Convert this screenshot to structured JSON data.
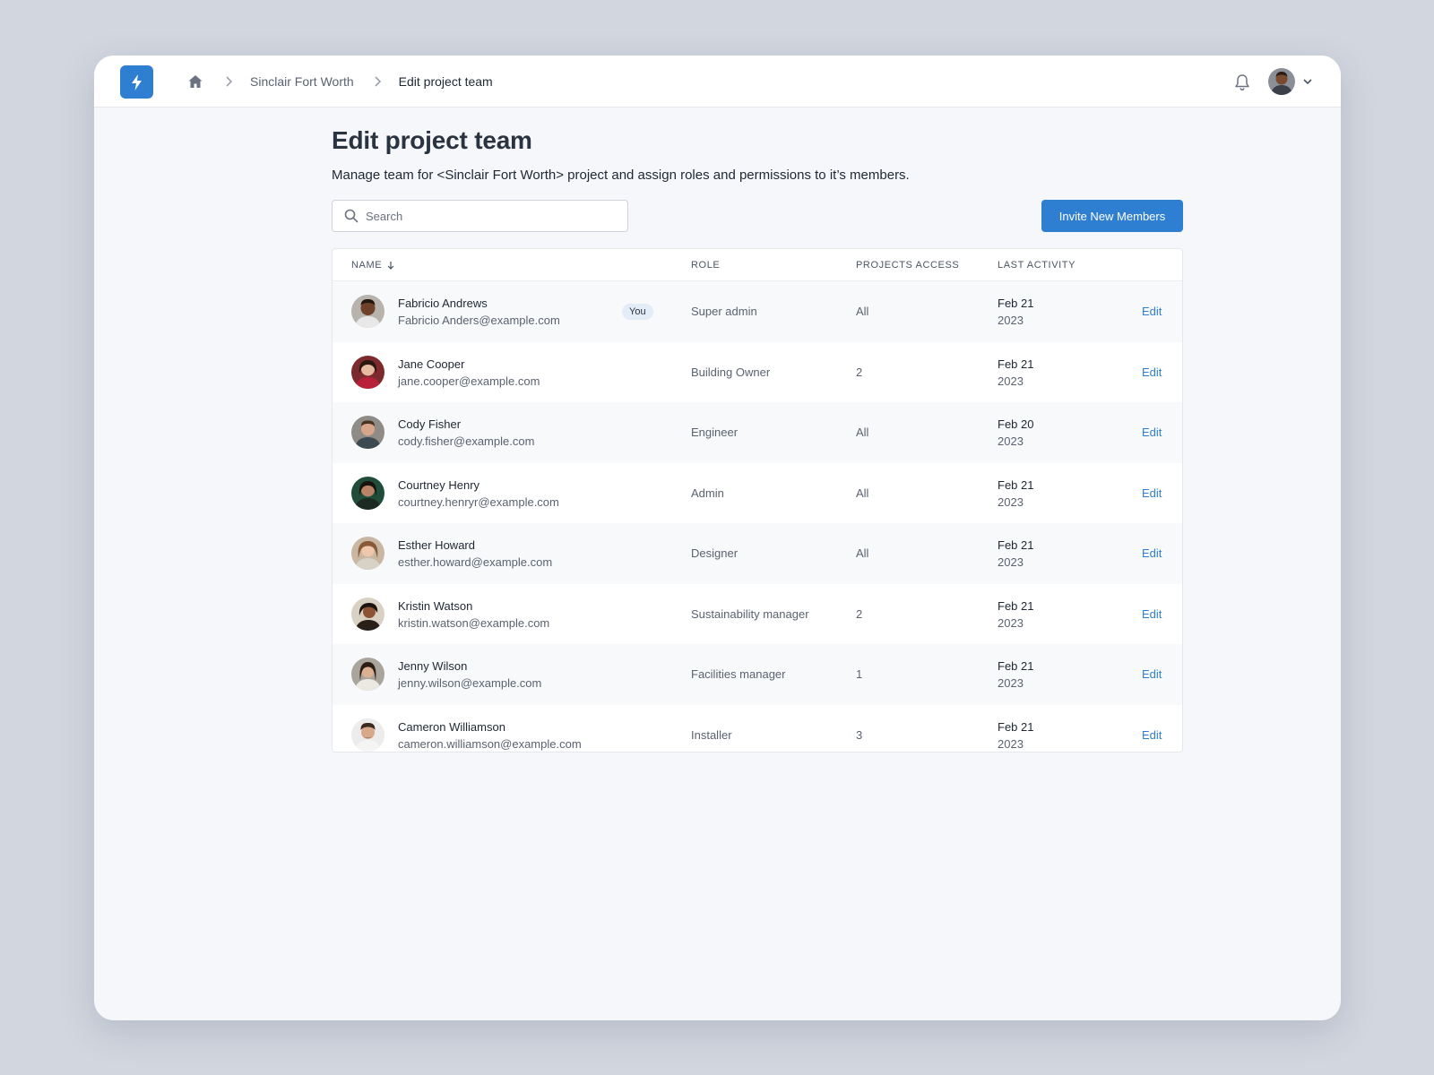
{
  "header": {
    "breadcrumb": [
      "Sinclair Fort Worth",
      "Edit project team"
    ],
    "icons": [
      "lightning-logo-icon",
      "home-icon",
      "chevron-right-icon",
      "bell-icon",
      "chevron-down-icon"
    ]
  },
  "page": {
    "title": "Edit project team",
    "subtitle": "Manage team for <Sinclair Fort Worth> project and assign roles and permissions to it’s members."
  },
  "toolbar": {
    "search_placeholder": "Search",
    "invite_label": "Invite New Members"
  },
  "table": {
    "columns": [
      "NAME",
      "ROLE",
      "PROJECTS ACCESS",
      "LAST ACTIVITY"
    ],
    "sort": "name-descending-arrow",
    "rows": [
      {
        "name": "Fabricio Andrews",
        "email": "Fabricio Anders@example.com",
        "badge": "You",
        "role": "Super admin",
        "access": "All",
        "date": "Feb 21",
        "year": "2023",
        "action": "Edit"
      },
      {
        "name": "Jane Cooper",
        "email": "jane.cooper@example.com",
        "role": "Building Owner",
        "access": "2",
        "date": "Feb 21",
        "year": "2023",
        "action": "Edit"
      },
      {
        "name": "Cody Fisher",
        "email": "cody.fisher@example.com",
        "role": "Engineer",
        "access": "All",
        "date": "Feb 20",
        "year": "2023",
        "action": "Edit"
      },
      {
        "name": "Courtney Henry",
        "email": "courtney.henryr@example.com",
        "role": "Admin",
        "access": "All",
        "date": "Feb 21",
        "year": "2023",
        "action": "Edit"
      },
      {
        "name": "Esther Howard",
        "email": "esther.howard@example.com",
        "role": "Designer",
        "access": "All",
        "date": "Feb 21",
        "year": "2023",
        "action": "Edit"
      },
      {
        "name": "Kristin Watson",
        "email": "kristin.watson@example.com",
        "role": "Sustainability manager",
        "access": "2",
        "date": "Feb 21",
        "year": "2023",
        "action": "Edit"
      },
      {
        "name": "Jenny Wilson",
        "email": "jenny.wilson@example.com",
        "role": "Facilities manager",
        "access": "1",
        "date": "Feb 21",
        "year": "2023",
        "action": "Edit"
      },
      {
        "name": "Cameron Williamson",
        "email": "cameron.williamson@example.com",
        "role": "Installer",
        "access": "3",
        "date": "Feb 21",
        "year": "2023",
        "action": "Edit"
      }
    ]
  },
  "colors": {
    "accent": "#2e7fd2",
    "background": "#d1d6df",
    "surface": "#f6f7fb"
  }
}
